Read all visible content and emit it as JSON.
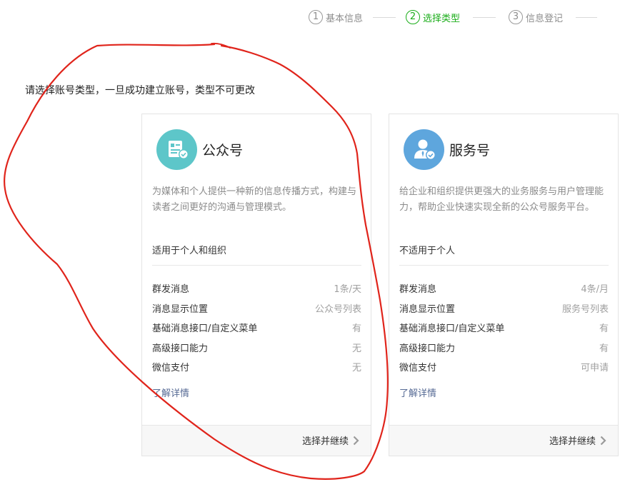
{
  "stepper": {
    "steps": [
      {
        "number": "1",
        "label": "基本信息",
        "state": "done"
      },
      {
        "number": "2",
        "label": "选择类型",
        "state": "active"
      },
      {
        "number": "3",
        "label": "信息登记",
        "state": "pending"
      }
    ],
    "active_color": "#1aad19"
  },
  "intro": "请选择账号类型，一旦成功建立账号，类型不可更改",
  "cards": [
    {
      "title": "公众号",
      "icon": "document-check-icon",
      "icon_color": "#5dc6c9",
      "description": "为媒体和个人提供一种新的信息传播方式，构建与读者之间更好的沟通与管理模式。",
      "suitable": "适用于个人和组织",
      "features": [
        {
          "name": "群发消息",
          "value": "1条/天"
        },
        {
          "name": "消息显示位置",
          "value": "公众号列表"
        },
        {
          "name": "基础消息接口/自定义菜单",
          "value": "有"
        },
        {
          "name": "高级接口能力",
          "value": "无"
        },
        {
          "name": "微信支付",
          "value": "无"
        }
      ],
      "more_link": "了解详情",
      "action": "选择并继续"
    },
    {
      "title": "服务号",
      "icon": "user-check-icon",
      "icon_color": "#5ea6dd",
      "description": "给企业和组织提供更强大的业务服务与用户管理能力，帮助企业快速实现全新的公众号服务平台。",
      "suitable": "不适用于个人",
      "features": [
        {
          "name": "群发消息",
          "value": "4条/月"
        },
        {
          "name": "消息显示位置",
          "value": "服务号列表"
        },
        {
          "name": "基础消息接口/自定义菜单",
          "value": "有"
        },
        {
          "name": "高级接口能力",
          "value": "有"
        },
        {
          "name": "微信支付",
          "value": "可申请"
        }
      ],
      "more_link": "了解详情",
      "action": "选择并继续"
    }
  ],
  "annotation_color": "#e0241b"
}
